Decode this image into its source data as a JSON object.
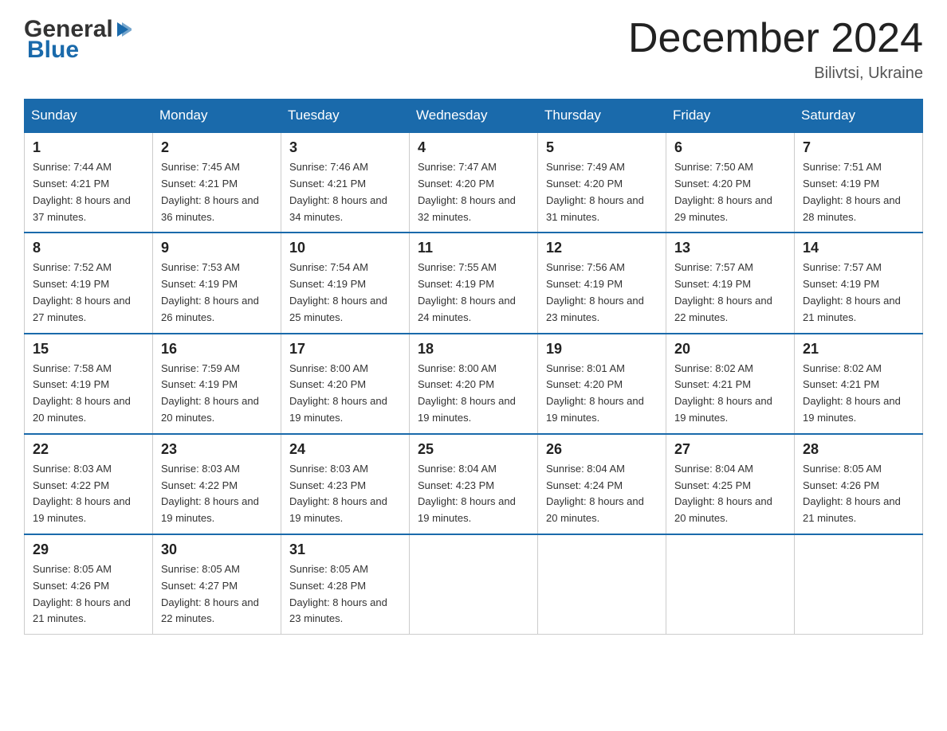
{
  "header": {
    "logo_general": "General",
    "logo_blue": "Blue",
    "month_title": "December 2024",
    "location": "Bilivtsi, Ukraine"
  },
  "days_of_week": [
    "Sunday",
    "Monday",
    "Tuesday",
    "Wednesday",
    "Thursday",
    "Friday",
    "Saturday"
  ],
  "weeks": [
    [
      {
        "day": "1",
        "sunrise": "7:44 AM",
        "sunset": "4:21 PM",
        "daylight": "8 hours and 37 minutes."
      },
      {
        "day": "2",
        "sunrise": "7:45 AM",
        "sunset": "4:21 PM",
        "daylight": "8 hours and 36 minutes."
      },
      {
        "day": "3",
        "sunrise": "7:46 AM",
        "sunset": "4:21 PM",
        "daylight": "8 hours and 34 minutes."
      },
      {
        "day": "4",
        "sunrise": "7:47 AM",
        "sunset": "4:20 PM",
        "daylight": "8 hours and 32 minutes."
      },
      {
        "day": "5",
        "sunrise": "7:49 AM",
        "sunset": "4:20 PM",
        "daylight": "8 hours and 31 minutes."
      },
      {
        "day": "6",
        "sunrise": "7:50 AM",
        "sunset": "4:20 PM",
        "daylight": "8 hours and 29 minutes."
      },
      {
        "day": "7",
        "sunrise": "7:51 AM",
        "sunset": "4:19 PM",
        "daylight": "8 hours and 28 minutes."
      }
    ],
    [
      {
        "day": "8",
        "sunrise": "7:52 AM",
        "sunset": "4:19 PM",
        "daylight": "8 hours and 27 minutes."
      },
      {
        "day": "9",
        "sunrise": "7:53 AM",
        "sunset": "4:19 PM",
        "daylight": "8 hours and 26 minutes."
      },
      {
        "day": "10",
        "sunrise": "7:54 AM",
        "sunset": "4:19 PM",
        "daylight": "8 hours and 25 minutes."
      },
      {
        "day": "11",
        "sunrise": "7:55 AM",
        "sunset": "4:19 PM",
        "daylight": "8 hours and 24 minutes."
      },
      {
        "day": "12",
        "sunrise": "7:56 AM",
        "sunset": "4:19 PM",
        "daylight": "8 hours and 23 minutes."
      },
      {
        "day": "13",
        "sunrise": "7:57 AM",
        "sunset": "4:19 PM",
        "daylight": "8 hours and 22 minutes."
      },
      {
        "day": "14",
        "sunrise": "7:57 AM",
        "sunset": "4:19 PM",
        "daylight": "8 hours and 21 minutes."
      }
    ],
    [
      {
        "day": "15",
        "sunrise": "7:58 AM",
        "sunset": "4:19 PM",
        "daylight": "8 hours and 20 minutes."
      },
      {
        "day": "16",
        "sunrise": "7:59 AM",
        "sunset": "4:19 PM",
        "daylight": "8 hours and 20 minutes."
      },
      {
        "day": "17",
        "sunrise": "8:00 AM",
        "sunset": "4:20 PM",
        "daylight": "8 hours and 19 minutes."
      },
      {
        "day": "18",
        "sunrise": "8:00 AM",
        "sunset": "4:20 PM",
        "daylight": "8 hours and 19 minutes."
      },
      {
        "day": "19",
        "sunrise": "8:01 AM",
        "sunset": "4:20 PM",
        "daylight": "8 hours and 19 minutes."
      },
      {
        "day": "20",
        "sunrise": "8:02 AM",
        "sunset": "4:21 PM",
        "daylight": "8 hours and 19 minutes."
      },
      {
        "day": "21",
        "sunrise": "8:02 AM",
        "sunset": "4:21 PM",
        "daylight": "8 hours and 19 minutes."
      }
    ],
    [
      {
        "day": "22",
        "sunrise": "8:03 AM",
        "sunset": "4:22 PM",
        "daylight": "8 hours and 19 minutes."
      },
      {
        "day": "23",
        "sunrise": "8:03 AM",
        "sunset": "4:22 PM",
        "daylight": "8 hours and 19 minutes."
      },
      {
        "day": "24",
        "sunrise": "8:03 AM",
        "sunset": "4:23 PM",
        "daylight": "8 hours and 19 minutes."
      },
      {
        "day": "25",
        "sunrise": "8:04 AM",
        "sunset": "4:23 PM",
        "daylight": "8 hours and 19 minutes."
      },
      {
        "day": "26",
        "sunrise": "8:04 AM",
        "sunset": "4:24 PM",
        "daylight": "8 hours and 20 minutes."
      },
      {
        "day": "27",
        "sunrise": "8:04 AM",
        "sunset": "4:25 PM",
        "daylight": "8 hours and 20 minutes."
      },
      {
        "day": "28",
        "sunrise": "8:05 AM",
        "sunset": "4:26 PM",
        "daylight": "8 hours and 21 minutes."
      }
    ],
    [
      {
        "day": "29",
        "sunrise": "8:05 AM",
        "sunset": "4:26 PM",
        "daylight": "8 hours and 21 minutes."
      },
      {
        "day": "30",
        "sunrise": "8:05 AM",
        "sunset": "4:27 PM",
        "daylight": "8 hours and 22 minutes."
      },
      {
        "day": "31",
        "sunrise": "8:05 AM",
        "sunset": "4:28 PM",
        "daylight": "8 hours and 23 minutes."
      },
      null,
      null,
      null,
      null
    ]
  ],
  "labels": {
    "sunrise": "Sunrise:",
    "sunset": "Sunset:",
    "daylight": "Daylight:"
  }
}
